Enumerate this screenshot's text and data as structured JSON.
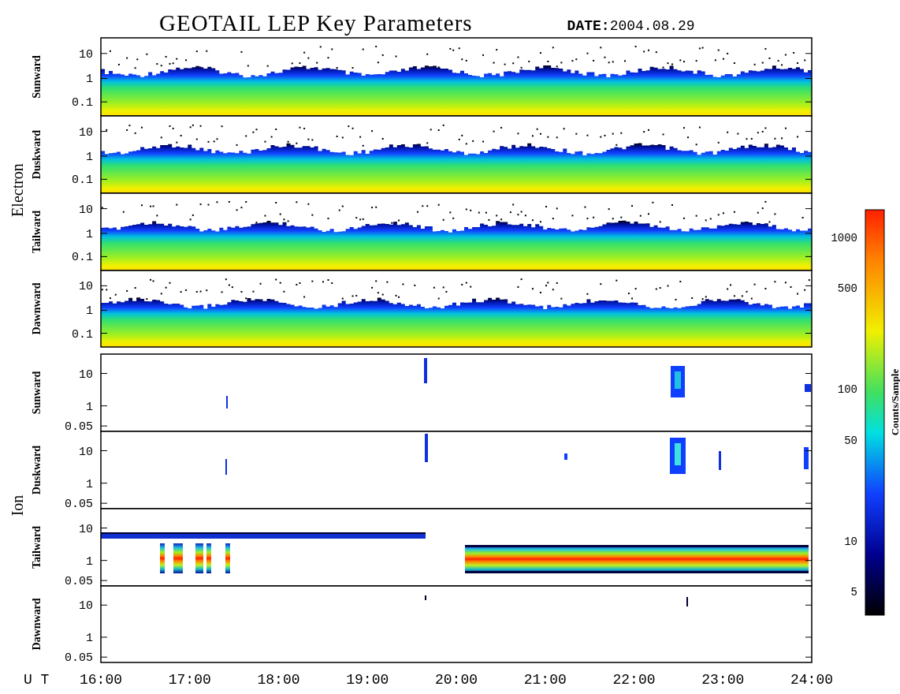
{
  "title": "GEOTAIL LEP Key Parameters",
  "date": "**DATE:**2004.08.29",
  "groups": [
    {
      "name": "Electron",
      "kind": "electron",
      "panels": [
        {
          "label": "Sunward",
          "yticks": [
            "10",
            "1",
            "0.1"
          ]
        },
        {
          "label": "Duskward",
          "yticks": [
            "10",
            "1",
            "0.1"
          ]
        },
        {
          "label": "Tailward",
          "yticks": [
            "10",
            "1",
            "0.1"
          ]
        },
        {
          "label": "Dawnward",
          "yticks": [
            "10",
            "1",
            "0.1"
          ]
        }
      ]
    },
    {
      "name": "Ion",
      "kind": "ion",
      "panels": [
        {
          "label": "Sunward",
          "yticks": [
            "10",
            "1",
            "0.05"
          ]
        },
        {
          "label": "Duskward",
          "yticks": [
            "10",
            "1",
            "0.05"
          ]
        },
        {
          "label": "Tailward",
          "yticks": [
            "10",
            "1",
            "0.05"
          ]
        },
        {
          "label": "Dawnward",
          "yticks": [
            "10",
            "1",
            "0.05"
          ]
        }
      ]
    }
  ],
  "x_axis": {
    "label": "U T",
    "ticks": [
      "16:00",
      "17:00",
      "18:00",
      "19:00",
      "20:00",
      "21:00",
      "22:00",
      "23:00",
      "24:00"
    ]
  },
  "colorbar": {
    "label": "Counts/Sample",
    "ticks": [
      "1000",
      "500",
      "100",
      "50",
      "10",
      "5"
    ]
  }
}
